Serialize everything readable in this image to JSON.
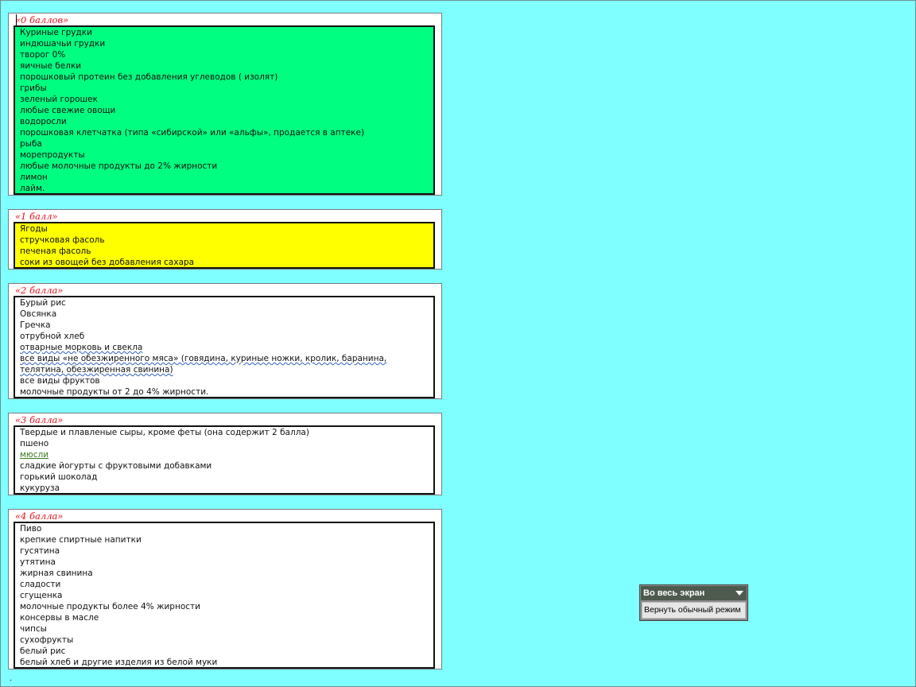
{
  "sections": [
    {
      "title": "«0 баллов»",
      "items": [
        "Куриные грудки",
        "индюшачьи грудки",
        "творог 0%",
        "яичные белки",
        "порошковый протеин без добавления углеводов ( изолят)",
        "грибы",
        "зеленый горошек",
        "любые свежие овощи",
        "водоросли",
        "порошковая клетчатка (типа «сибирской» или «альфы», продается в аптеке)",
        "рыба",
        "морепродукты",
        "любые молочные продукты до 2% жирности",
        "лимон",
        "лайм."
      ]
    },
    {
      "title": "«1 балл»",
      "items": [
        "Ягоды",
        "стручковая фасоль",
        "печеная фасоль",
        "соки из овощей без добавления сахара"
      ]
    },
    {
      "title": "«2 балла»",
      "items": [
        "Бурый рис",
        "Овсянка",
        "Гречка",
        "отрубной хлеб",
        "отварные морковь и свекла",
        "все виды «не обезжиренного мяса» (говядина, куриные ножки, кролик, баранина,",
        "телятина, обезжиренная свинина)",
        "все виды фруктов",
        "молочные продукты от 2 до 4% жирности."
      ]
    },
    {
      "title": "«3 балла»",
      "items": [
        "Твердые и плавленые сыры, кроме феты (она содержит 2 балла)",
        "пшено",
        "мюсли",
        "сладкие йогурты с фруктовыми добавками",
        "горький шоколад",
        "кукуруза"
      ]
    },
    {
      "title": "«4 балла»",
      "items": [
        "Пиво",
        "крепкие спиртные напитки",
        "гусятина",
        "утятина",
        "жирная свинина",
        "сладости",
        "сгущенка",
        "молочные продукты более 4% жирности",
        "консервы в масле",
        "чипсы",
        "сухофрукты",
        "белый рис",
        "белый хлеб и другие изделия из белой муки"
      ]
    }
  ],
  "end_mark": ".",
  "fullscreen_toolbar": {
    "title": "Во весь экран",
    "restore_button": "Вернуть обычный режим"
  },
  "colors": {
    "background": "#7fffff",
    "section0_fill": "#00ff80",
    "section1_fill": "#ffff00",
    "title_red": "#e8101c"
  }
}
